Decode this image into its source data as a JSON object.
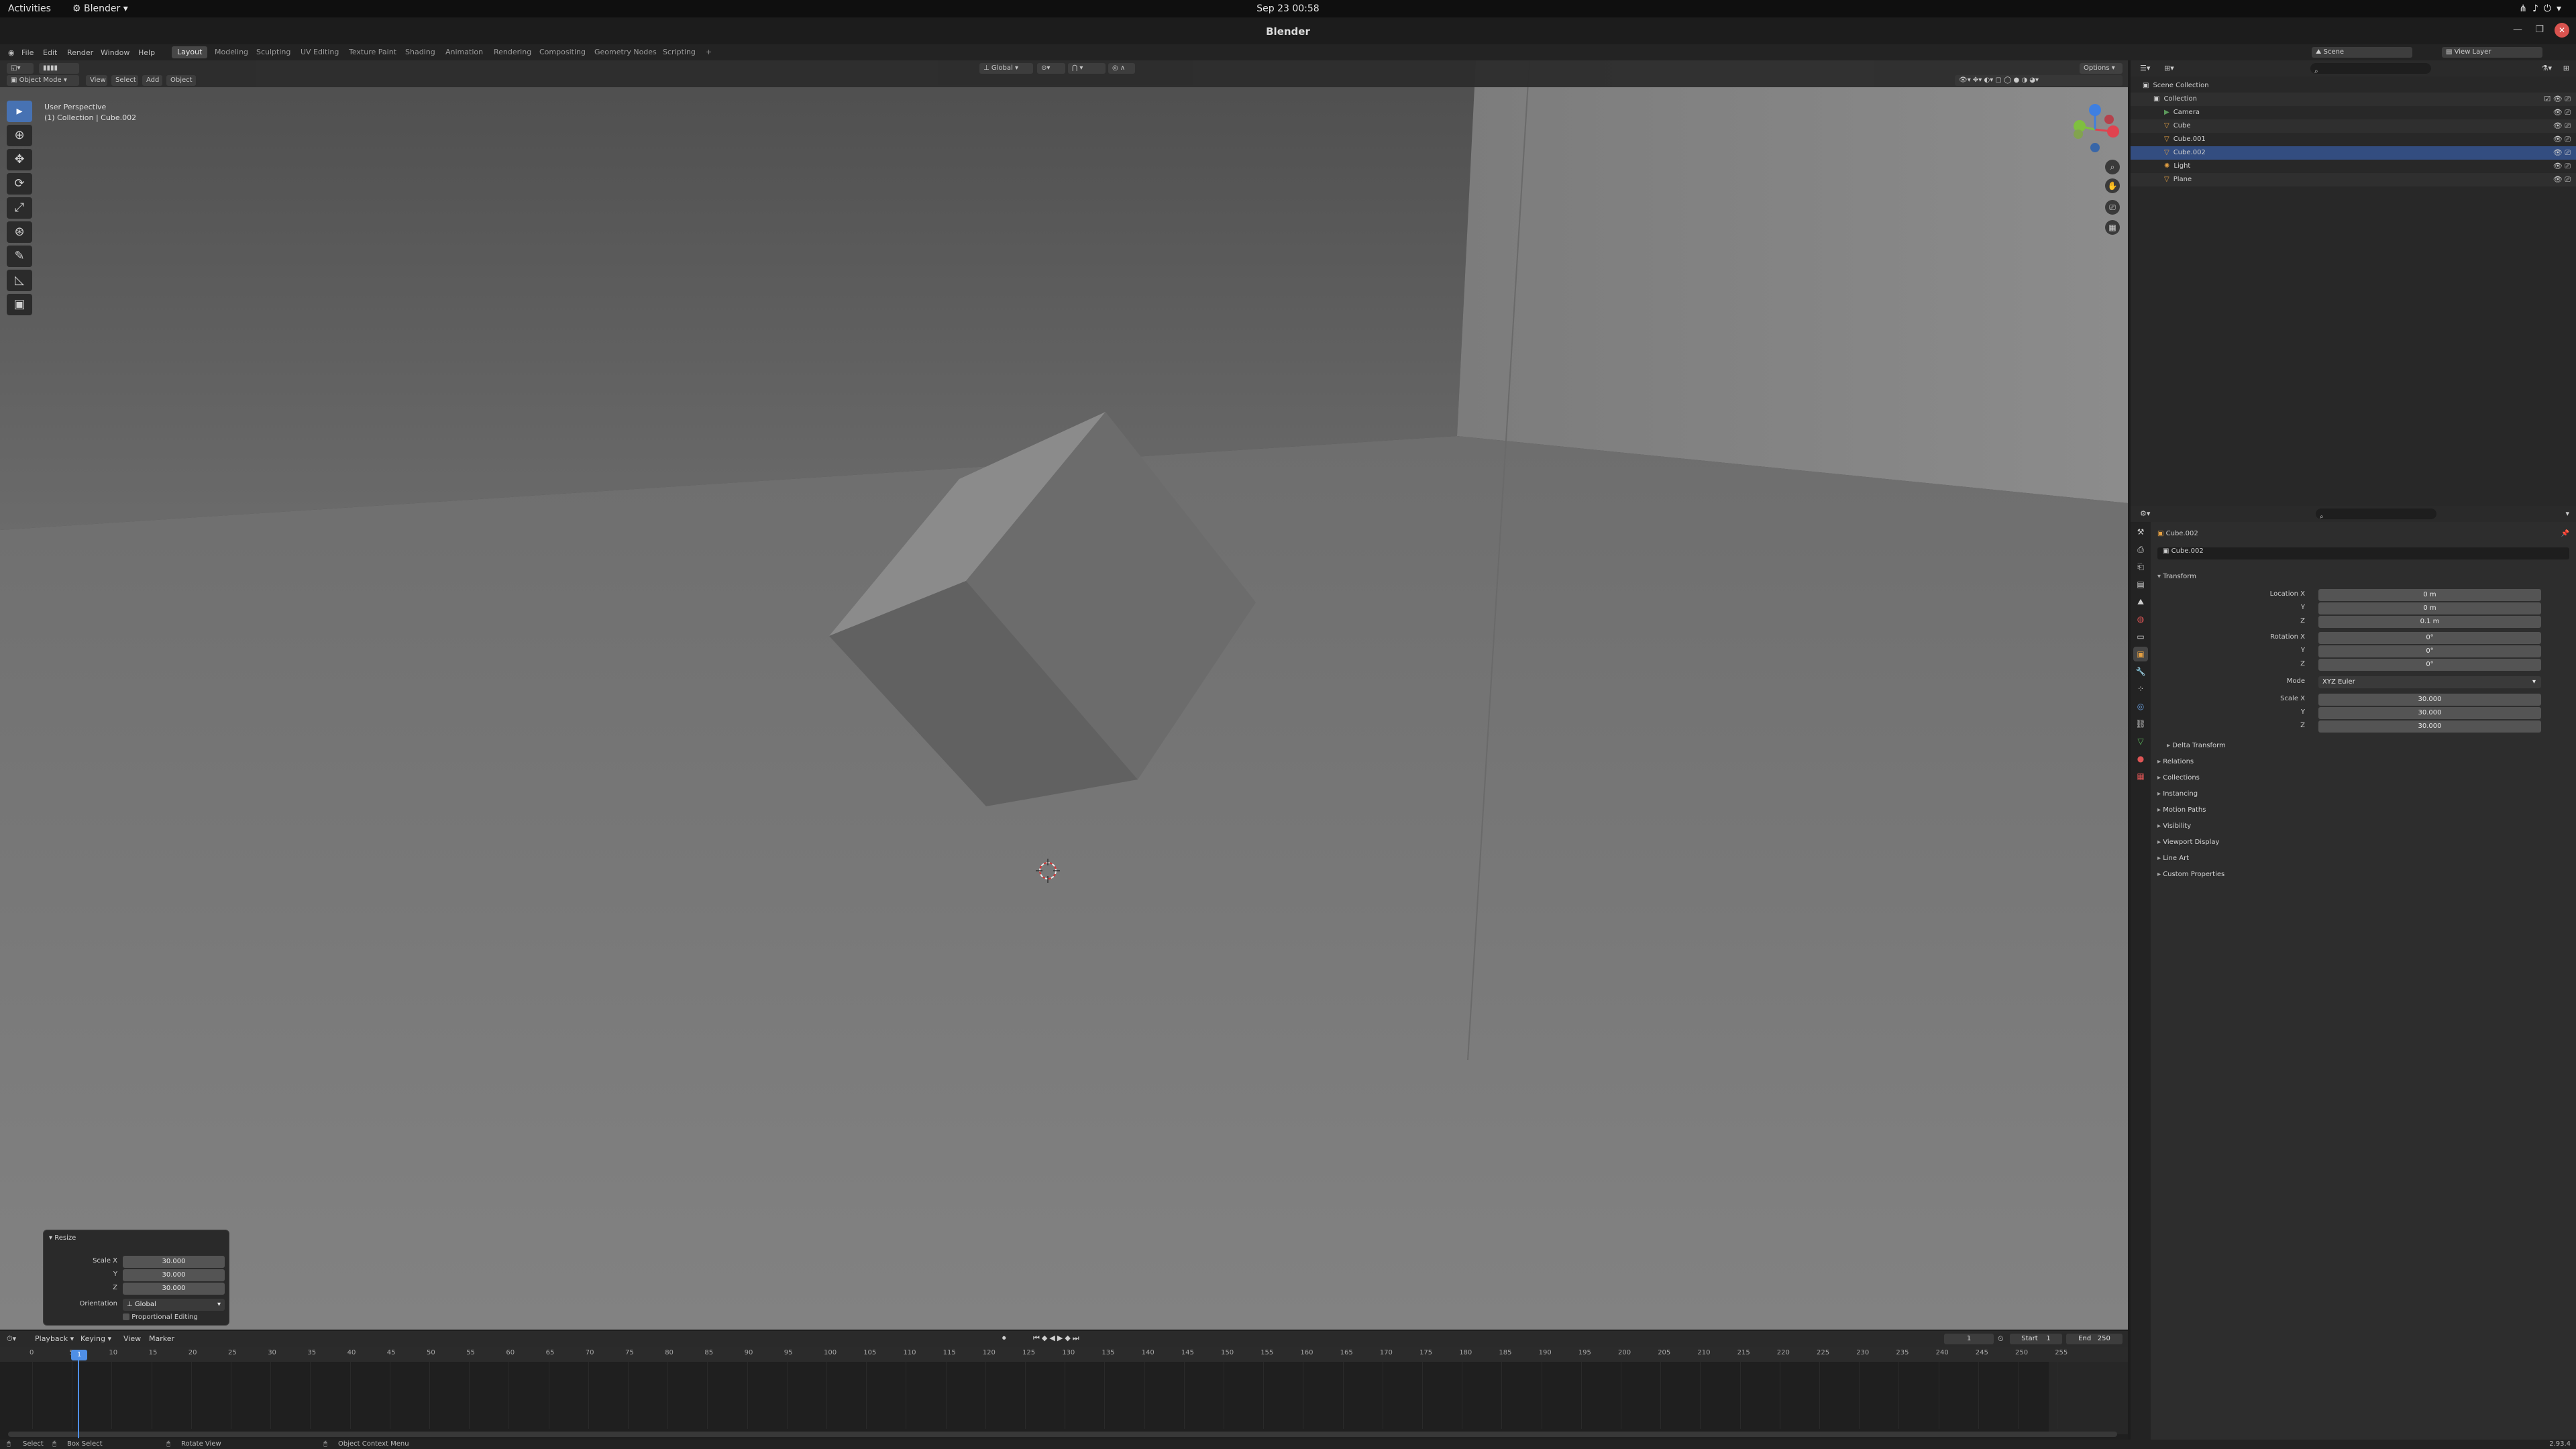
{
  "gnome": {
    "activities": "Activities",
    "app_name": "Blender",
    "datetime": "Sep 23  00:58"
  },
  "window": {
    "title": "Blender"
  },
  "menu": [
    "File",
    "Edit",
    "Render",
    "Window",
    "Help"
  ],
  "workspaces": [
    "Layout",
    "Modeling",
    "Sculpting",
    "UV Editing",
    "Texture Paint",
    "Shading",
    "Animation",
    "Rendering",
    "Compositing",
    "Geometry Nodes",
    "Scripting",
    "+"
  ],
  "active_workspace": "Layout",
  "scene": {
    "label": "Scene",
    "view_layer": "View Layer"
  },
  "viewport": {
    "mode": "Object Mode",
    "menus": [
      "View",
      "Select",
      "Add",
      "Object"
    ],
    "transform_orientation": "Global",
    "options": "Options",
    "perspective": "User Perspective",
    "context": "(1) Collection | Cube.002"
  },
  "toolbar": {
    "tools": [
      {
        "name": "select-box",
        "glyph": "▸",
        "active": true
      },
      {
        "name": "cursor",
        "glyph": "⊕",
        "active": false
      },
      {
        "name": "move",
        "glyph": "✥",
        "active": false
      },
      {
        "name": "rotate",
        "glyph": "⟳",
        "active": false
      },
      {
        "name": "scale",
        "glyph": "⤢",
        "active": false
      },
      {
        "name": "transform",
        "glyph": "⊛",
        "active": false
      },
      {
        "name": "annotate",
        "glyph": "✎",
        "active": false
      },
      {
        "name": "measure",
        "glyph": "◺",
        "active": false
      },
      {
        "name": "add-cube",
        "glyph": "▣",
        "active": false
      }
    ]
  },
  "resize_panel": {
    "title": "Resize",
    "scale_x_label": "Scale X",
    "scale_x": "30.000",
    "scale_y_label": "Y",
    "scale_y": "30.000",
    "scale_z_label": "Z",
    "scale_z": "30.000",
    "orientation_label": "Orientation",
    "orientation": "Global",
    "proportional": "Proportional Editing"
  },
  "timeline": {
    "menus": [
      "Playback",
      "Keying",
      "View",
      "Marker"
    ],
    "current_frame": "1",
    "frame_box": "1",
    "start_label": "Start",
    "start": "1",
    "end_label": "End",
    "end": "250",
    "ticks": [
      "0",
      "5",
      "10",
      "15",
      "20",
      "25",
      "30",
      "35",
      "40",
      "45",
      "50",
      "55",
      "60",
      "65",
      "70",
      "75",
      "80",
      "85",
      "90",
      "95",
      "100",
      "105",
      "110",
      "115",
      "120",
      "125",
      "130",
      "135",
      "140",
      "145",
      "150",
      "155",
      "160",
      "165",
      "170",
      "175",
      "180",
      "185",
      "190",
      "195",
      "200",
      "205",
      "210",
      "215",
      "220",
      "225",
      "230",
      "235",
      "240",
      "245",
      "250",
      "255"
    ]
  },
  "statusbar": {
    "select": "Select",
    "box_select": "Box Select",
    "rotate_view": "Rotate View",
    "context_menu": "Object Context Menu",
    "version": "2.93.4"
  },
  "outliner": {
    "root": "Scene Collection",
    "collection": "Collection",
    "items": [
      {
        "name": "Camera",
        "type": "camera",
        "selected": false
      },
      {
        "name": "Cube",
        "type": "mesh",
        "selected": false
      },
      {
        "name": "Cube.001",
        "type": "mesh",
        "selected": false
      },
      {
        "name": "Cube.002",
        "type": "mesh",
        "selected": true
      },
      {
        "name": "Light",
        "type": "light",
        "selected": false
      },
      {
        "name": "Plane",
        "type": "mesh",
        "selected": false
      }
    ]
  },
  "properties": {
    "object_name": "Cube.002",
    "object_field": "Cube.002",
    "transform": "Transform",
    "location_x_label": "Location X",
    "location_x": "0 m",
    "location_y_label": "Y",
    "location_y": "0 m",
    "location_z_label": "Z",
    "location_z": "0.1 m",
    "rotation_x_label": "Rotation X",
    "rotation_x": "0°",
    "rotation_y_label": "Y",
    "rotation_y": "0°",
    "rotation_z_label": "Z",
    "rotation_z": "0°",
    "mode_label": "Mode",
    "mode": "XYZ Euler",
    "scale_x_label": "Scale X",
    "scale_x": "30.000",
    "scale_y_label": "Y",
    "scale_y": "30.000",
    "scale_z_label": "Z",
    "scale_z": "30.000",
    "delta_transform": "Delta Transform",
    "sections": [
      "Relations",
      "Collections",
      "Instancing",
      "Motion Paths",
      "Visibility",
      "Viewport Display",
      "Line Art",
      "Custom Properties"
    ]
  },
  "colors": {
    "accent": "#4772b3",
    "selected_row": "#334d80",
    "axis_x": "#e0434f",
    "axis_y": "#7fbf3f",
    "axis_z": "#3f7fe0"
  }
}
